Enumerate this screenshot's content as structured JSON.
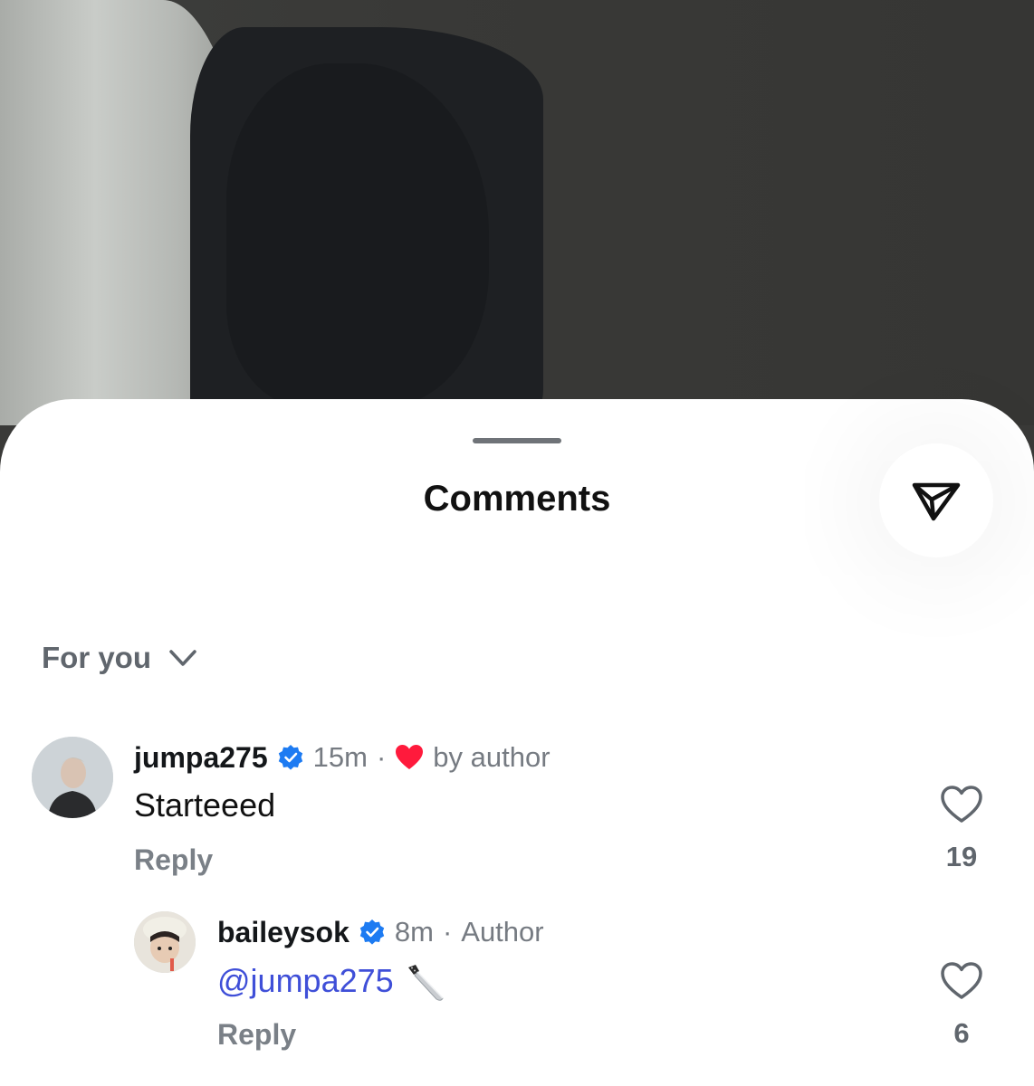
{
  "sheet": {
    "title": "Comments",
    "share_icon": "send-icon"
  },
  "sort": {
    "label": "For you",
    "icon": "chevron-down-icon"
  },
  "colors": {
    "mention": "#3f4fd8",
    "verified": "#1d7bf2",
    "liked_heart": "#ff1a3c",
    "muted_text": "#767b82"
  },
  "comments": [
    {
      "username": "jumpa275",
      "verified": true,
      "time": "15m",
      "separator": "·",
      "liked_by_author_label": "by author",
      "text": "Starteeed",
      "reply_label": "Reply",
      "like_count": "19"
    },
    {
      "username": "baileysok",
      "verified": true,
      "time": "8m",
      "separator": "·",
      "author_tag": "Author",
      "mention": "@jumpa275",
      "emoji": "knife-icon",
      "reply_label": "Reply",
      "like_count": "6"
    }
  ]
}
